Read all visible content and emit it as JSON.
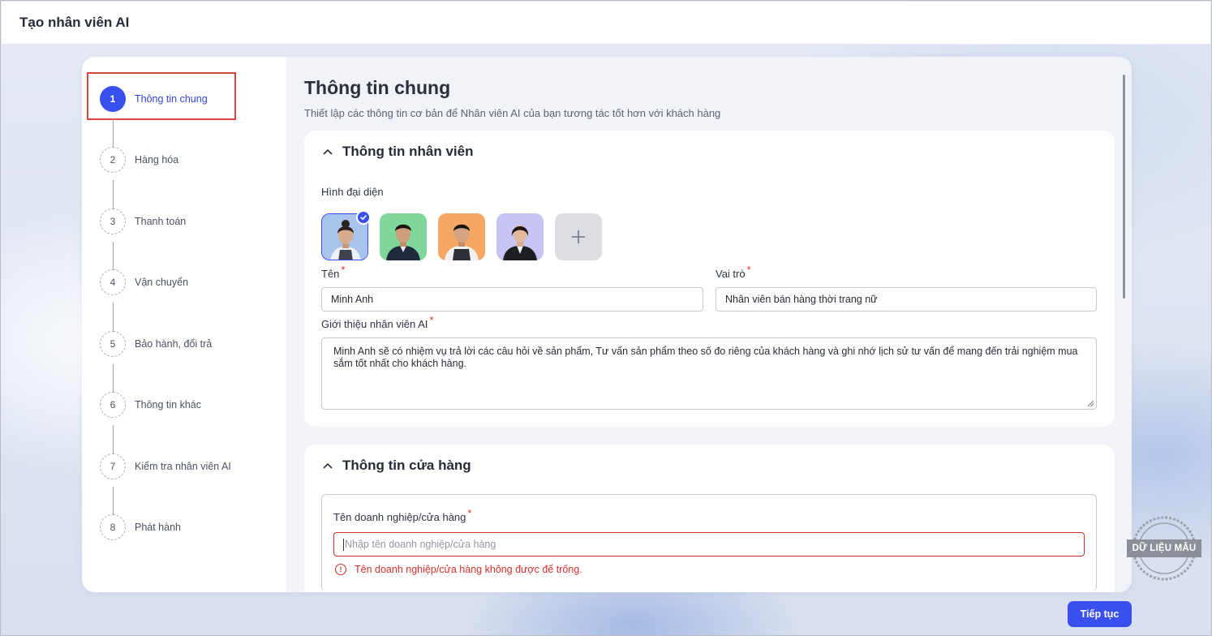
{
  "app": {
    "title": "Tạo nhân viên AI"
  },
  "steps": [
    {
      "number": "1",
      "label": "Thông tin chung",
      "active": true
    },
    {
      "number": "2",
      "label": "Hàng hóa"
    },
    {
      "number": "3",
      "label": "Thanh toán"
    },
    {
      "number": "4",
      "label": "Vận chuyển"
    },
    {
      "number": "5",
      "label": "Bảo hành, đổi trả"
    },
    {
      "number": "6",
      "label": "Thông tin khác"
    },
    {
      "number": "7",
      "label": "Kiểm tra nhân viên AI"
    },
    {
      "number": "8",
      "label": "Phát hành"
    }
  ],
  "main": {
    "title": "Thông tin chung",
    "subtitle": "Thiết lập các thông tin cơ bản để Nhân viên AI của bạn tương tác tốt hơn với khách hàng"
  },
  "employee": {
    "section_title": "Thông tin nhân viên",
    "avatar_label": "Hình đại diện",
    "avatars": [
      {
        "name": "female-apron",
        "selected": true
      },
      {
        "name": "male-green"
      },
      {
        "name": "male-apron"
      },
      {
        "name": "female-suit"
      }
    ],
    "name_label": "Tên",
    "name_value": "Minh Anh",
    "role_label": "Vai trò",
    "role_value": "Nhân viên bán hàng thời trang nữ",
    "intro_label": "Giới thiệu nhân viên AI",
    "intro_value": "Minh Anh sẽ có nhiệm vụ trả lời các câu hỏi về sản phẩm, Tư vấn sản phẩm theo số đo riêng của khách hàng và ghi nhớ lịch sử tư vấn để mang đến trải nghiệm mua sắm tốt nhất cho khách hàng.",
    "required_mark": "*"
  },
  "store": {
    "section_title": "Thông tin cửa hàng",
    "business_label": "Tên doanh nghiệp/cửa hàng",
    "business_placeholder": "Nhập tên doanh nghiệp/cửa hàng",
    "business_error": "Tên doanh nghiệp/cửa hàng không được để trống."
  },
  "watermark": {
    "text": "DỮ LIỆU MẪU"
  },
  "actions": {
    "next_label": "Tiếp tục"
  },
  "colors": {
    "primary": "#3a4ff0",
    "error": "#d4302b",
    "highlight": "#d9443f"
  }
}
